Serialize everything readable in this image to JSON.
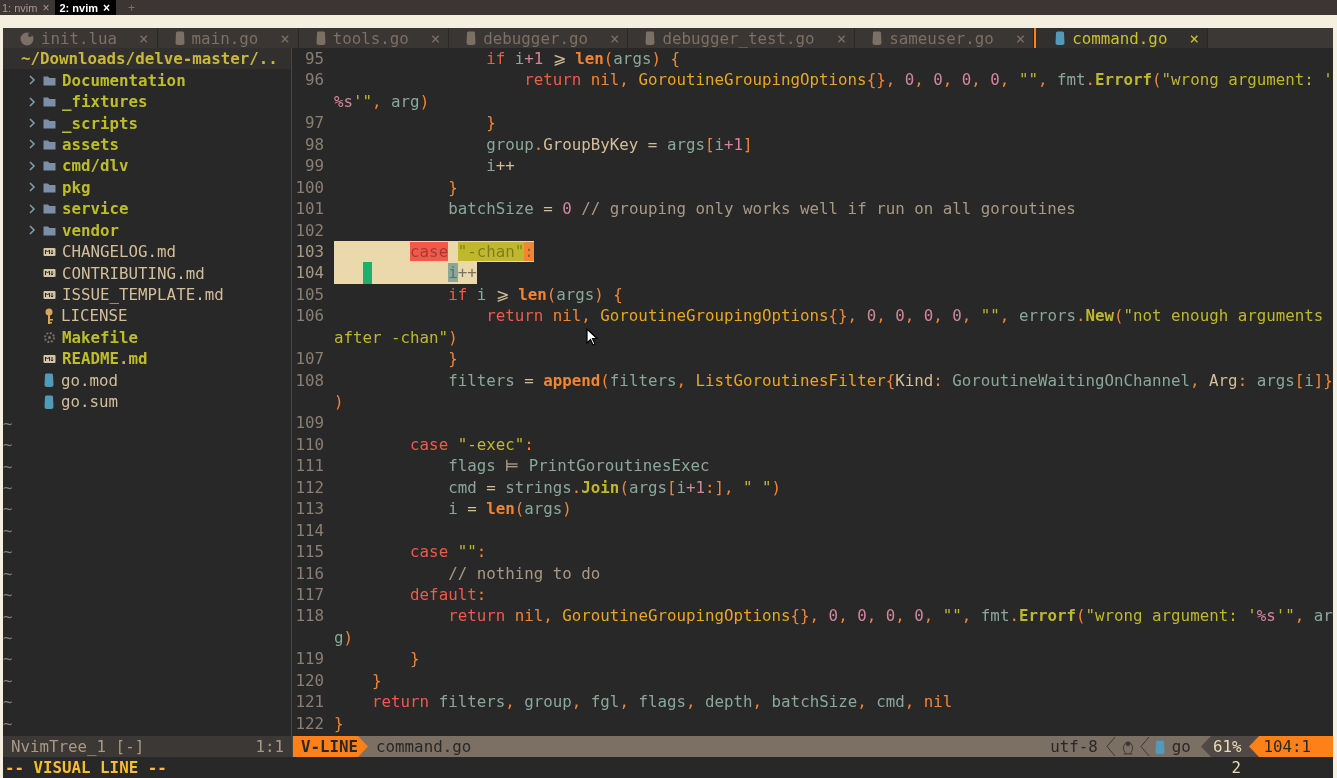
{
  "terminal_tabs": [
    {
      "label": "1: nvim",
      "close": "×",
      "selected": false
    },
    {
      "label": "2: nvim",
      "close": "×",
      "selected": true
    }
  ],
  "new_tab": "+",
  "buffer_tabs": [
    {
      "label": "init.lua",
      "kind": "lua",
      "close": "×",
      "selected": false
    },
    {
      "label": "main.go",
      "kind": "generic",
      "close": "×",
      "selected": false
    },
    {
      "label": "tools.go",
      "kind": "generic",
      "close": "×",
      "selected": false
    },
    {
      "label": "debugger.go",
      "kind": "generic",
      "close": "×",
      "selected": false
    },
    {
      "label": "debugger_test.go",
      "kind": "generic",
      "close": "×",
      "selected": false
    },
    {
      "label": "sameuser.go",
      "kind": "generic",
      "close": "×",
      "selected": false
    },
    {
      "label": "command.go",
      "kind": "go",
      "close": "×",
      "selected": true
    }
  ],
  "tree": {
    "root": "~/Downloads/delve-master/..",
    "items": [
      {
        "label": "Documentation",
        "kind": "folder",
        "expanded": false
      },
      {
        "label": "_fixtures",
        "kind": "folder",
        "expanded": false
      },
      {
        "label": "_scripts",
        "kind": "folder",
        "expanded": false
      },
      {
        "label": "assets",
        "kind": "folder",
        "expanded": false
      },
      {
        "label": "cmd/dlv",
        "kind": "folder",
        "expanded": false
      },
      {
        "label": "pkg",
        "kind": "folder",
        "expanded": false
      },
      {
        "label": "service",
        "kind": "folder",
        "expanded": false
      },
      {
        "label": "vendor",
        "kind": "folder",
        "expanded": false
      },
      {
        "label": "CHANGELOG.md",
        "kind": "markdown",
        "special": false
      },
      {
        "label": "CONTRIBUTING.md",
        "kind": "markdown",
        "special": false
      },
      {
        "label": "ISSUE_TEMPLATE.md",
        "kind": "markdown",
        "special": false
      },
      {
        "label": "LICENSE",
        "kind": "license",
        "special": false
      },
      {
        "label": "Makefile",
        "kind": "makefile",
        "special": true
      },
      {
        "label": "README.md",
        "kind": "markdown",
        "special": true
      },
      {
        "label": "go.mod",
        "kind": "go",
        "special": false
      },
      {
        "label": "go.sum",
        "kind": "go",
        "special": false
      }
    ],
    "filler": [
      "~",
      "~",
      "~",
      "~",
      "~",
      "~",
      "~",
      "~",
      "~",
      "~",
      "~",
      "~",
      "~",
      "~",
      "~"
    ]
  },
  "code_lines": [
    {
      "number": "95",
      "selected": false,
      "tokens": [
        {
          "kind": "kw",
          "text": "                if "
        },
        {
          "kind": "var",
          "text": "i"
        },
        {
          "kind": "num",
          "text": "+1"
        },
        {
          "kind": "op",
          "text": " ⩾ "
        },
        {
          "kind": "fn",
          "text": "len"
        },
        {
          "kind": "punct",
          "text": "("
        },
        {
          "kind": "var",
          "text": "args"
        },
        {
          "kind": "punct",
          "text": ") {"
        }
      ]
    },
    {
      "number": "96",
      "selected": false,
      "tokens": [
        {
          "kind": "kw",
          "text": "                    return "
        },
        {
          "kind": "const",
          "text": "nil"
        },
        {
          "kind": "punct",
          "text": ", "
        },
        {
          "kind": "type",
          "text": "GoroutineGroupingOptions"
        },
        {
          "kind": "punct",
          "text": "{}, "
        },
        {
          "kind": "num",
          "text": "0"
        },
        {
          "kind": "punct",
          "text": ", "
        },
        {
          "kind": "num",
          "text": "0"
        },
        {
          "kind": "punct",
          "text": ", "
        },
        {
          "kind": "num",
          "text": "0"
        },
        {
          "kind": "punct",
          "text": ", "
        },
        {
          "kind": "num",
          "text": "0"
        },
        {
          "kind": "punct",
          "text": ", "
        },
        {
          "kind": "str",
          "text": "\"\""
        },
        {
          "kind": "punct",
          "text": ", "
        },
        {
          "kind": "var",
          "text": "fmt"
        },
        {
          "kind": "punct",
          "text": "."
        },
        {
          "kind": "call",
          "text": "Errorf"
        },
        {
          "kind": "punct",
          "text": "("
        },
        {
          "kind": "str",
          "text": "\"wrong argument: '"
        }
      ]
    },
    {
      "selected": false,
      "tokens": [
        {
          "kind": "esc",
          "text": "%s"
        },
        {
          "kind": "str",
          "text": "'\""
        },
        {
          "kind": "punct",
          "text": ", "
        },
        {
          "kind": "var",
          "text": "arg"
        },
        {
          "kind": "punct",
          "text": ")"
        }
      ]
    },
    {
      "number": "97",
      "selected": false,
      "tokens": [
        {
          "kind": "punct",
          "text": "                }"
        }
      ]
    },
    {
      "number": "98",
      "selected": false,
      "tokens": [
        {
          "kind": "var",
          "text": "                group"
        },
        {
          "kind": "punct",
          "text": "."
        },
        {
          "kind": "field",
          "text": "GroupByKey"
        },
        {
          "kind": "op",
          "text": " = "
        },
        {
          "kind": "var",
          "text": "args"
        },
        {
          "kind": "punct",
          "text": "["
        },
        {
          "kind": "var",
          "text": "i"
        },
        {
          "kind": "num",
          "text": "+1"
        },
        {
          "kind": "punct",
          "text": "]"
        }
      ]
    },
    {
      "number": "99",
      "selected": false,
      "tokens": [
        {
          "kind": "var",
          "text": "                i"
        },
        {
          "kind": "op",
          "text": "++"
        }
      ]
    },
    {
      "number": "100",
      "selected": false,
      "tokens": [
        {
          "kind": "punct",
          "text": "            }"
        }
      ]
    },
    {
      "number": "101",
      "selected": false,
      "tokens": [
        {
          "kind": "var",
          "text": "            batchSize"
        },
        {
          "kind": "op",
          "text": " = "
        },
        {
          "kind": "num",
          "text": "0"
        },
        {
          "kind": "comment",
          "text": " // grouping only works well if run on all goroutines"
        }
      ]
    },
    {
      "number": "102",
      "selected": false
    },
    {
      "number": "103",
      "selected": true,
      "tokens": [
        {
          "kind": "kw",
          "text": "        case "
        },
        {
          "kind": "str",
          "text": "\"-chan\""
        },
        {
          "kind": "punct",
          "text": ":"
        }
      ]
    },
    {
      "number": "104",
      "selected": true,
      "tokens": [
        {
          "kind": "cursor"
        },
        {
          "kind": "var",
          "text": "        i"
        },
        {
          "kind": "op",
          "text": "++"
        }
      ]
    },
    {
      "number": "105",
      "selected": false,
      "tokens": [
        {
          "kind": "kw",
          "text": "            if "
        },
        {
          "kind": "var",
          "text": "i"
        },
        {
          "kind": "op",
          "text": " ⩾ "
        },
        {
          "kind": "fn",
          "text": "len"
        },
        {
          "kind": "punct",
          "text": "("
        },
        {
          "kind": "var",
          "text": "args"
        },
        {
          "kind": "punct",
          "text": ") {"
        }
      ]
    },
    {
      "number": "106",
      "selected": false,
      "tokens": [
        {
          "kind": "kw",
          "text": "                return "
        },
        {
          "kind": "const",
          "text": "nil"
        },
        {
          "kind": "punct",
          "text": ", "
        },
        {
          "kind": "type",
          "text": "GoroutineGroupingOptions"
        },
        {
          "kind": "punct",
          "text": "{}, "
        },
        {
          "kind": "num",
          "text": "0"
        },
        {
          "kind": "punct",
          "text": ", "
        },
        {
          "kind": "num",
          "text": "0"
        },
        {
          "kind": "punct",
          "text": ", "
        },
        {
          "kind": "num",
          "text": "0"
        },
        {
          "kind": "punct",
          "text": ", "
        },
        {
          "kind": "num",
          "text": "0"
        },
        {
          "kind": "punct",
          "text": ", "
        },
        {
          "kind": "str",
          "text": "\"\""
        },
        {
          "kind": "punct",
          "text": ", "
        },
        {
          "kind": "var",
          "text": "errors"
        },
        {
          "kind": "punct",
          "text": "."
        },
        {
          "kind": "call",
          "text": "New"
        },
        {
          "kind": "punct",
          "text": "("
        },
        {
          "kind": "str",
          "text": "\"not enough arguments"
        }
      ]
    },
    {
      "selected": false,
      "tokens": [
        {
          "kind": "str",
          "text": "after -chan\""
        },
        {
          "kind": "punct",
          "text": ")"
        }
      ]
    },
    {
      "number": "107",
      "selected": false,
      "tokens": [
        {
          "kind": "punct",
          "text": "            }"
        }
      ]
    },
    {
      "number": "108",
      "selected": false,
      "tokens": [
        {
          "kind": "var",
          "text": "            filters"
        },
        {
          "kind": "op",
          "text": " = "
        },
        {
          "kind": "fn",
          "text": "append"
        },
        {
          "kind": "punct",
          "text": "("
        },
        {
          "kind": "var",
          "text": "filters"
        },
        {
          "kind": "punct",
          "text": ", "
        },
        {
          "kind": "type",
          "text": "ListGoroutinesFilter"
        },
        {
          "kind": "punct",
          "text": "{"
        },
        {
          "kind": "field",
          "text": "Kind"
        },
        {
          "kind": "punct",
          "text": ": "
        },
        {
          "kind": "var",
          "text": "GoroutineWaitingOnChannel"
        },
        {
          "kind": "punct",
          "text": ", "
        },
        {
          "kind": "field",
          "text": "Arg"
        },
        {
          "kind": "punct",
          "text": ": "
        },
        {
          "kind": "var",
          "text": "args"
        },
        {
          "kind": "punct",
          "text": "["
        },
        {
          "kind": "var",
          "text": "i"
        },
        {
          "kind": "punct",
          "text": "]}"
        }
      ]
    },
    {
      "selected": false,
      "tokens": [
        {
          "kind": "punct",
          "text": ")"
        }
      ]
    },
    {
      "number": "109",
      "selected": false
    },
    {
      "number": "110",
      "selected": false,
      "tokens": [
        {
          "kind": "kw",
          "text": "        case "
        },
        {
          "kind": "str",
          "text": "\"-exec\""
        },
        {
          "kind": "punct",
          "text": ":"
        }
      ]
    },
    {
      "number": "111",
      "selected": false,
      "tokens": [
        {
          "kind": "var",
          "text": "            flags"
        },
        {
          "kind": "op",
          "text": " ⊨ "
        },
        {
          "kind": "var",
          "text": "PrintGoroutinesExec"
        }
      ]
    },
    {
      "number": "112",
      "selected": false,
      "tokens": [
        {
          "kind": "var",
          "text": "            cmd"
        },
        {
          "kind": "op",
          "text": " = "
        },
        {
          "kind": "var",
          "text": "strings"
        },
        {
          "kind": "punct",
          "text": "."
        },
        {
          "kind": "call",
          "text": "Join"
        },
        {
          "kind": "punct",
          "text": "("
        },
        {
          "kind": "var",
          "text": "args"
        },
        {
          "kind": "punct",
          "text": "["
        },
        {
          "kind": "var",
          "text": "i"
        },
        {
          "kind": "num",
          "text": "+1"
        },
        {
          "kind": "punct",
          "text": ":], "
        },
        {
          "kind": "str",
          "text": "\" \""
        },
        {
          "kind": "punct",
          "text": ")"
        }
      ]
    },
    {
      "number": "113",
      "selected": false,
      "tokens": [
        {
          "kind": "var",
          "text": "            i"
        },
        {
          "kind": "op",
          "text": " = "
        },
        {
          "kind": "fn",
          "text": "len"
        },
        {
          "kind": "punct",
          "text": "("
        },
        {
          "kind": "var",
          "text": "args"
        },
        {
          "kind": "punct",
          "text": ")"
        }
      ]
    },
    {
      "number": "114",
      "selected": false
    },
    {
      "number": "115",
      "selected": false,
      "tokens": [
        {
          "kind": "kw",
          "text": "        case "
        },
        {
          "kind": "str",
          "text": "\"\""
        },
        {
          "kind": "punct",
          "text": ":"
        }
      ]
    },
    {
      "number": "116",
      "selected": false,
      "tokens": [
        {
          "kind": "comment",
          "text": "            // nothing to do"
        }
      ]
    },
    {
      "number": "117",
      "selected": false,
      "tokens": [
        {
          "kind": "kw",
          "text": "        default"
        },
        {
          "kind": "punct",
          "text": ":"
        }
      ]
    },
    {
      "number": "118",
      "selected": false,
      "tokens": [
        {
          "kind": "kw",
          "text": "            return "
        },
        {
          "kind": "const",
          "text": "nil"
        },
        {
          "kind": "punct",
          "text": ", "
        },
        {
          "kind": "type",
          "text": "GoroutineGroupingOptions"
        },
        {
          "kind": "punct",
          "text": "{}, "
        },
        {
          "kind": "num",
          "text": "0"
        },
        {
          "kind": "punct",
          "text": ", "
        },
        {
          "kind": "num",
          "text": "0"
        },
        {
          "kind": "punct",
          "text": ", "
        },
        {
          "kind": "num",
          "text": "0"
        },
        {
          "kind": "punct",
          "text": ", "
        },
        {
          "kind": "num",
          "text": "0"
        },
        {
          "kind": "punct",
          "text": ", "
        },
        {
          "kind": "str",
          "text": "\"\""
        },
        {
          "kind": "punct",
          "text": ", "
        },
        {
          "kind": "var",
          "text": "fmt"
        },
        {
          "kind": "punct",
          "text": "."
        },
        {
          "kind": "call",
          "text": "Errorf"
        },
        {
          "kind": "punct",
          "text": "("
        },
        {
          "kind": "str",
          "text": "\"wrong argument: '"
        },
        {
          "kind": "esc",
          "text": "%s"
        },
        {
          "kind": "str",
          "text": "'\""
        },
        {
          "kind": "punct",
          "text": ", "
        },
        {
          "kind": "var",
          "text": "ar"
        }
      ]
    },
    {
      "selected": false,
      "tokens": [
        {
          "kind": "var",
          "text": "g"
        },
        {
          "kind": "punct",
          "text": ")"
        }
      ]
    },
    {
      "number": "119",
      "selected": false,
      "tokens": [
        {
          "kind": "punct",
          "text": "        }"
        }
      ]
    },
    {
      "number": "120",
      "selected": false,
      "tokens": [
        {
          "kind": "punct",
          "text": "    }"
        }
      ]
    },
    {
      "number": "121",
      "selected": false,
      "tokens": [
        {
          "kind": "kw",
          "text": "    return "
        },
        {
          "kind": "var",
          "text": "filters"
        },
        {
          "kind": "punct",
          "text": ", "
        },
        {
          "kind": "var",
          "text": "group"
        },
        {
          "kind": "punct",
          "text": ", "
        },
        {
          "kind": "var",
          "text": "fgl"
        },
        {
          "kind": "punct",
          "text": ", "
        },
        {
          "kind": "var",
          "text": "flags"
        },
        {
          "kind": "punct",
          "text": ", "
        },
        {
          "kind": "var",
          "text": "depth"
        },
        {
          "kind": "punct",
          "text": ", "
        },
        {
          "kind": "var",
          "text": "batchSize"
        },
        {
          "kind": "punct",
          "text": ", "
        },
        {
          "kind": "var",
          "text": "cmd"
        },
        {
          "kind": "punct",
          "text": ", "
        },
        {
          "kind": "const",
          "text": "nil"
        }
      ]
    },
    {
      "number": "122",
      "selected": false,
      "tokens": [
        {
          "kind": "punct",
          "text": "}"
        }
      ]
    }
  ],
  "tree_status": {
    "name": "NvimTree_1 [-]",
    "position": "1:1"
  },
  "status_line": {
    "mode": "V-LINE",
    "file": "command.go",
    "encoding": "utf-8",
    "filetype": "go",
    "percent": "61%",
    "position": "104:1"
  },
  "command_line": {
    "message": "-- VISUAL LINE --",
    "count": "2"
  }
}
